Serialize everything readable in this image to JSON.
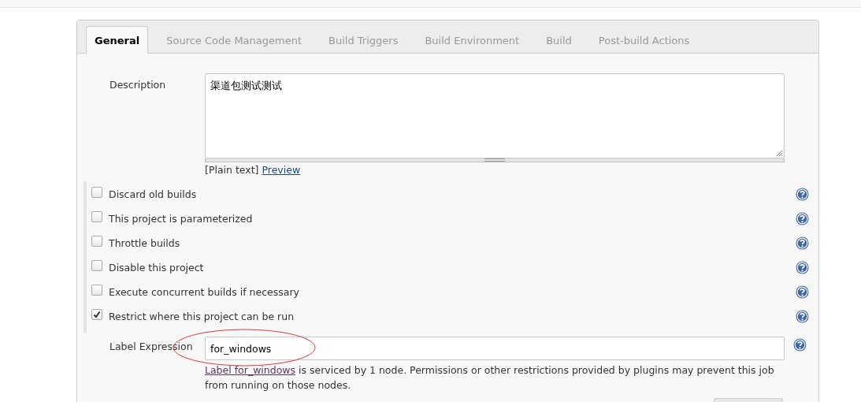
{
  "tabs": [
    {
      "label": "General",
      "selected": true
    },
    {
      "label": "Source Code Management",
      "selected": false
    },
    {
      "label": "Build Triggers",
      "selected": false
    },
    {
      "label": "Build Environment",
      "selected": false
    },
    {
      "label": "Build",
      "selected": false
    },
    {
      "label": "Post-build Actions",
      "selected": false
    }
  ],
  "description": {
    "label": "Description",
    "value": "渠道包测试测试",
    "format_note": "[Plain text]",
    "preview_link": "Preview"
  },
  "options": [
    {
      "label": "Discard old builds",
      "checked": false
    },
    {
      "label": "This project is parameterized",
      "checked": false
    },
    {
      "label": "Throttle builds",
      "checked": false
    },
    {
      "label": "Disable this project",
      "checked": false
    },
    {
      "label": "Execute concurrent builds if necessary",
      "checked": false
    },
    {
      "label": "Restrict where this project can be run",
      "checked": true
    }
  ],
  "label_expression": {
    "label": "Label Expression",
    "value": "for_windows",
    "note_link": "Label for_windows",
    "note_text": "is serviced by 1 node. Permissions or other restrictions provided by plugins may prevent this job from running on those nodes."
  }
}
